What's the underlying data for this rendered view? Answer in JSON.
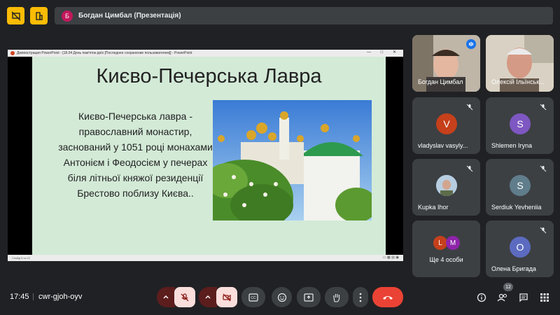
{
  "topbar": {
    "presenter_initial": "Б",
    "title": "Богдан Цимбал (Презентація)",
    "accent": "#fbbc04"
  },
  "presentation": {
    "window_title": "Демонстрация PowerPoint - [18.04 День пам'яток.pptx [Последнее сохранение пользователем]] - PowerPoint",
    "slide_title": "Києво-Печерська Лавра",
    "slide_body": "Києво-Печерська лавра - православний монастир, заснований у 1051 році монахами Антонієм і Феодосієм у печерах біля літньої княжої резиденції Брестово поблизу Києва..",
    "status_left": "Слайд 5 из 21",
    "slide_bg": "#d3ead7"
  },
  "participants": [
    {
      "name": "Богдан Цимбал",
      "type": "video",
      "speaking": true
    },
    {
      "name": "Олексій Ільїнськ...",
      "type": "video"
    },
    {
      "name": "vladyslav vasyly...",
      "initial": "V",
      "color": "#c5401b",
      "muted": true
    },
    {
      "name": "Shlemen Iryna",
      "initial": "S",
      "color": "#7e57c2",
      "muted": true
    },
    {
      "name": "Kupka Ihor",
      "type": "photo",
      "muted": true
    },
    {
      "name": "Serdiuk Yevheniia",
      "initial": "S",
      "color": "#607d8b",
      "muted": true
    },
    {
      "name": "Ще 4 особи",
      "type": "more",
      "initials": [
        "L",
        "M"
      ],
      "colors": [
        "#c5401b",
        "#8e24aa"
      ]
    },
    {
      "name": "Олена Бригада",
      "initial": "O",
      "color": "#5c6bc0",
      "muted": true
    }
  ],
  "bottom": {
    "time": "17:45",
    "meeting_code": "cwr-gjoh-oyv",
    "participants_count": "12"
  },
  "icons": {
    "mic_off": "mic-off-icon",
    "cam_off": "camera-off-icon",
    "cc": "captions-icon",
    "emoji": "emoji-icon",
    "present": "present-icon",
    "hand": "raise-hand-icon",
    "more": "more-vert-icon",
    "hangup": "hangup-icon",
    "info": "info-icon",
    "people": "people-icon",
    "chat": "chat-icon",
    "activities": "activities-icon"
  }
}
